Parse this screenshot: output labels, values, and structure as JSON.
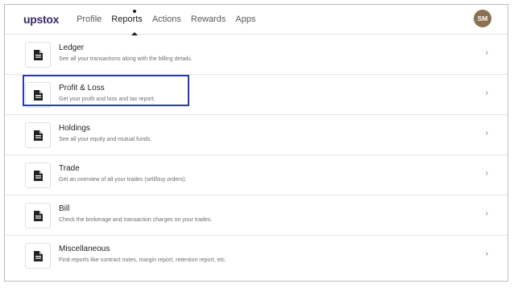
{
  "brand": {
    "logo_text": "upstox"
  },
  "nav": [
    {
      "label": "Profile"
    },
    {
      "label": "Reports"
    },
    {
      "label": "Actions"
    },
    {
      "label": "Rewards"
    },
    {
      "label": "Apps"
    }
  ],
  "user": {
    "initials": "SM"
  },
  "reports": [
    {
      "title": "Ledger",
      "description": "See all your transactions along with the billing details."
    },
    {
      "title": "Profit & Loss",
      "description": "Get your profit and loss and tax report."
    },
    {
      "title": "Holdings",
      "description": "See all your equity and mutual funds."
    },
    {
      "title": "Trade",
      "description": "Get an overview of all your trades (sell/buy orders)."
    },
    {
      "title": "Bill",
      "description": "Check the brokerage and transaction charges on your trades."
    },
    {
      "title": "Miscellaneous",
      "description": "Find reports like contract notes, margin report, retention report, etc."
    }
  ],
  "chevron": "›",
  "colors": {
    "accent": "#2a3bb0",
    "avatar": "#8b7150",
    "brand": "#3b2a68"
  },
  "icon": "document-icon"
}
